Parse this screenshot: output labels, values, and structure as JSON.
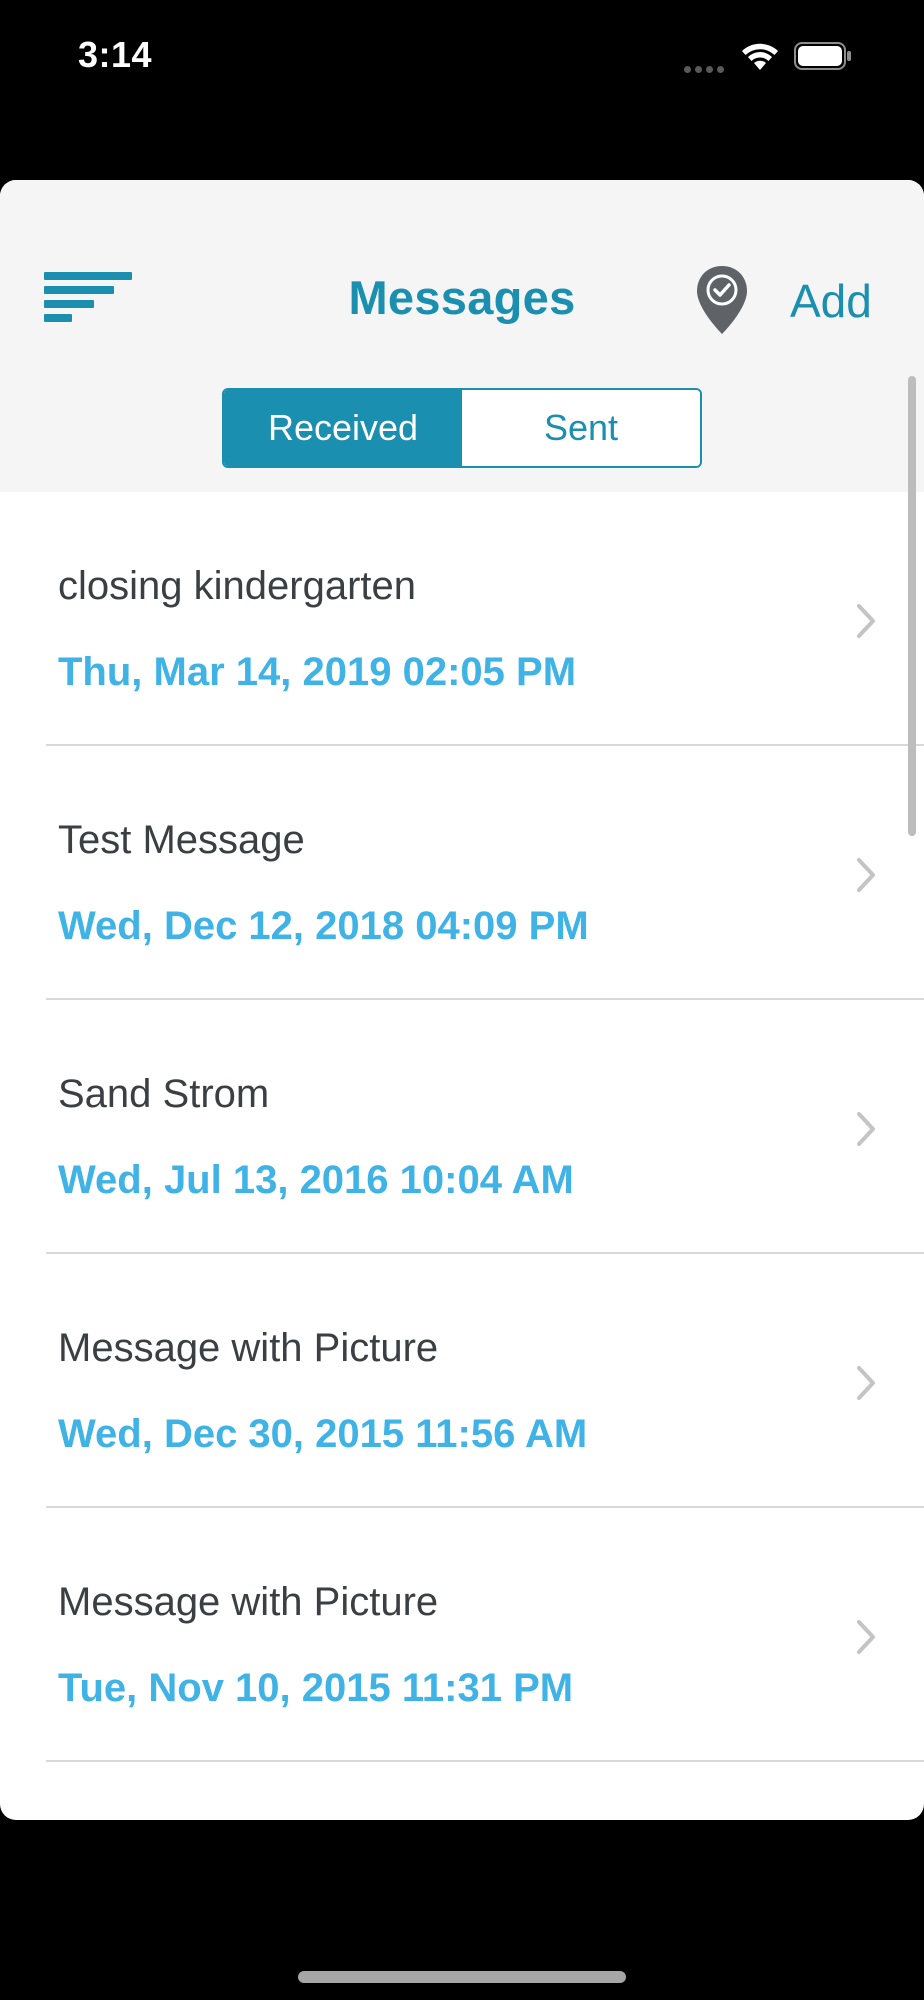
{
  "status_bar": {
    "time": "3:14"
  },
  "header": {
    "title": "Messages",
    "add_label": "Add"
  },
  "tabs": [
    {
      "label": "Received",
      "active": true
    },
    {
      "label": "Sent",
      "active": false
    }
  ],
  "messages": [
    {
      "title": "closing kindergarten",
      "date": "Thu, Mar 14, 2019 02:05 PM"
    },
    {
      "title": "Test Message",
      "date": "Wed, Dec 12, 2018 04:09 PM"
    },
    {
      "title": "Sand Strom",
      "date": "Wed, Jul 13, 2016 10:04 AM"
    },
    {
      "title": "Message with Picture",
      "date": "Wed, Dec 30, 2015 11:56 AM"
    },
    {
      "title": "Message with Picture",
      "date": "Tue, Nov 10, 2015 11:31 PM"
    }
  ],
  "colors": {
    "accent": "#1a8fb0",
    "date_text": "#3fb2e6",
    "title_text": "#3a3f44",
    "nav_background": "#f5f5f5"
  }
}
